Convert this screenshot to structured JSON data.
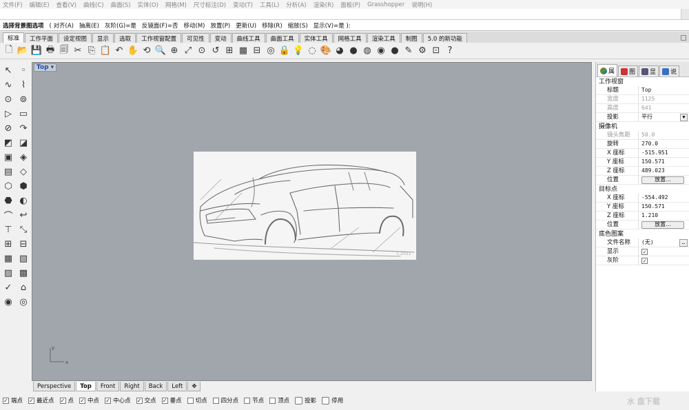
{
  "menubar": [
    "文件(F)",
    "编辑(E)",
    "查看(V)",
    "曲线(C)",
    "曲面(S)",
    "实体(O)",
    "网格(M)",
    "尺寸标注(D)",
    "变动(T)",
    "工具(L)",
    "分析(A)",
    "渲染(R)",
    "面板(P)",
    "Grasshopper",
    "说明(H)"
  ],
  "command_history": "",
  "command_line": {
    "prompt": "选择背景图选项",
    "options": [
      "( 对齐(A)",
      "抽离(E)",
      "灰阶(G)=是",
      "反镜面(F)=否",
      "移动(M)",
      "放置(P)",
      "更新(U)",
      "移除(R)",
      "缩放(S)",
      "显示(V)=是 ):"
    ]
  },
  "toolbar_tabs": [
    "标准",
    "工作平面",
    "设定视图",
    "显示",
    "选取",
    "工作视窗配置",
    "可见性",
    "变动",
    "曲线工具",
    "曲面工具",
    "实体工具",
    "网格工具",
    "渲染工具",
    "制图",
    "5.0 的新功能"
  ],
  "toolbar_icons": [
    "new-icon",
    "open-icon",
    "save-icon",
    "print-icon",
    "import-icon",
    "cut-icon",
    "copy-icon",
    "paste-icon",
    "undo-icon",
    "pan-icon",
    "rotate-view-icon",
    "zoom-icon",
    "zoom-window-icon",
    "zoom-extents-icon",
    "zoom-selected-icon",
    "undo-view-icon",
    "four-view-icon",
    "cplane-icon",
    "grid-snap-icon",
    "target-icon",
    "lock-icon",
    "light-icon",
    "hide-icon",
    "material-icon",
    "color-wheel-icon",
    "render-sphere-icon",
    "shaded-sphere-icon",
    "render-icon",
    "sphere-icon",
    "paint-icon",
    "settings-icon",
    "layout-icon",
    "help-icon"
  ],
  "left_tools": [
    "↖",
    "◦",
    "∿",
    "⌇",
    "⊙",
    "⊚",
    "▷",
    "▭",
    "⊘",
    "↷",
    "◩",
    "◪",
    "▣",
    "◈",
    "▤",
    "◇",
    "⬡",
    "⬢",
    "⬣",
    "◐",
    "⌒",
    "↩",
    "⊤",
    "⤡",
    "⊞",
    "⊟",
    "▦",
    "▧",
    "▨",
    "▩",
    "✓",
    "⌂",
    "◉",
    "◎"
  ],
  "viewport": {
    "title": "Top",
    "dropdown": "▾",
    "axis_y": "y",
    "axis_x": "x"
  },
  "view_tabs": [
    "Perspective",
    "Top",
    "Front",
    "Right",
    "Back",
    "Left"
  ],
  "view_tabs_add": "✥",
  "osnaps": [
    {
      "label": "端点",
      "checked": true
    },
    {
      "label": "最近点",
      "checked": true
    },
    {
      "label": "点",
      "checked": true
    },
    {
      "label": "中点",
      "checked": true
    },
    {
      "label": "中心点",
      "checked": true
    },
    {
      "label": "交点",
      "checked": true
    },
    {
      "label": "垂点",
      "checked": true
    },
    {
      "label": "切点",
      "checked": false
    },
    {
      "label": "四分点",
      "checked": false
    },
    {
      "label": "节点",
      "checked": false
    },
    {
      "label": "顶点",
      "checked": false
    }
  ],
  "osnap_buttons": [
    "投影",
    "停用"
  ],
  "panel": {
    "tabs": [
      "属",
      "图",
      "显",
      "说"
    ],
    "sections": {
      "viewport": "工作视窗",
      "camera": "摄像机",
      "target": "目标点",
      "wallpaper": "底色图案"
    },
    "title_label": "标题",
    "title_value": "Top",
    "width_label": "宽度",
    "width_value": "1125",
    "height_label": "高度",
    "height_value": "641",
    "projection_label": "投影",
    "projection_value": "平行",
    "lens_label": "镜头焦距",
    "lens_value": "50.0",
    "rotation_label": "旋转",
    "rotation_value": "270.0",
    "cam_x_label": "X 座标",
    "cam_x_value": "-515.951",
    "cam_y_label": "Y 座标",
    "cam_y_value": "150.571",
    "cam_z_label": "Z 座标",
    "cam_z_value": "489.023",
    "position_label": "位置",
    "place_button": "放置...",
    "tgt_x_label": "X 座标",
    "tgt_x_value": "-554.492",
    "tgt_y_label": "Y 座标",
    "tgt_y_value": "150.571",
    "tgt_z_label": "Z 座标",
    "tgt_z_value": "1.210",
    "tgt_position_label": "位置",
    "tgt_place_button": "放置...",
    "filename_label": "文件名称",
    "filename_value": "(无)",
    "show_label": "显示",
    "gray_label": "灰阶"
  },
  "sketch_signature": "L.2021",
  "watermark": "水 盘下载"
}
